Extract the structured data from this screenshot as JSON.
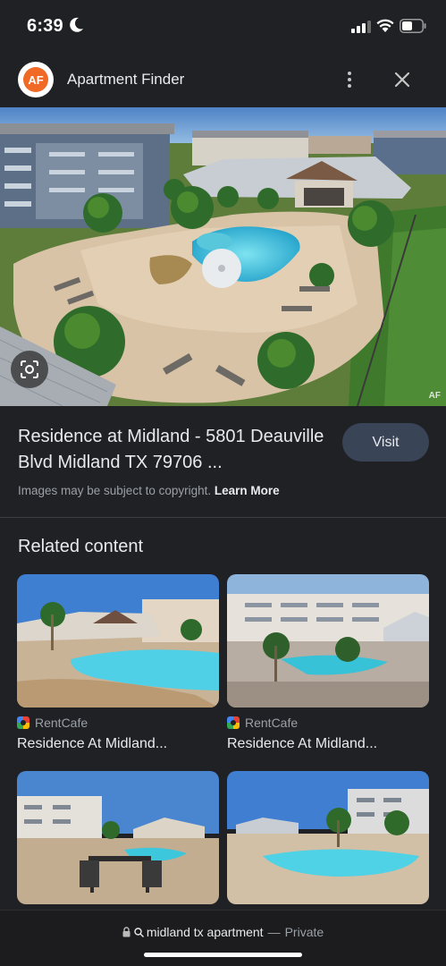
{
  "status_bar": {
    "time": "6:39"
  },
  "app": {
    "title": "Apartment Finder",
    "logo_text": "AF"
  },
  "hero": {
    "watermark": "AF"
  },
  "result": {
    "title": "Residence at Midland - 5801 Deauville Blvd Midland TX 79706 ...",
    "visit_label": "Visit",
    "copyright_text": "Images may be subject to copyright.",
    "learn_more": "Learn More"
  },
  "related": {
    "heading": "Related content",
    "cards": [
      {
        "source": "RentCafe",
        "title": "Residence At Midland..."
      },
      {
        "source": "RentCafe",
        "title": "Residence At Midland..."
      },
      {
        "source": "",
        "title": ""
      },
      {
        "source": "",
        "title": ""
      }
    ]
  },
  "bottom_bar": {
    "url": "midland tx apartment",
    "separator": "—",
    "mode": "Private"
  },
  "colors": {
    "background": "#202124",
    "visit_button": "#394457",
    "logo_accent": "#f06a25"
  }
}
